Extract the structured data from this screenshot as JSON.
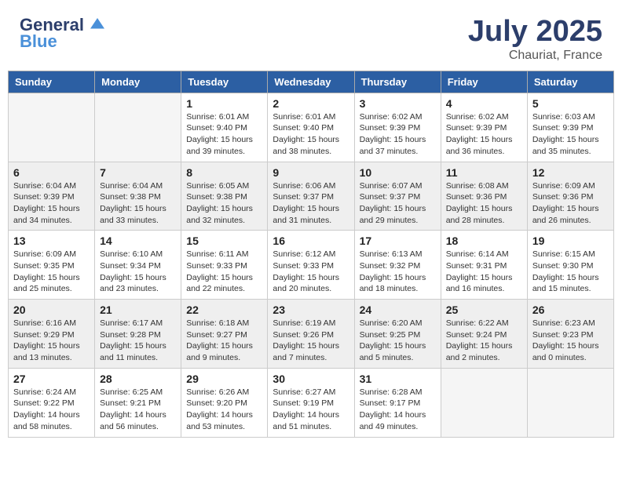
{
  "header": {
    "logo_line1": "General",
    "logo_line2": "Blue",
    "month_year": "July 2025",
    "location": "Chauriat, France"
  },
  "columns": [
    "Sunday",
    "Monday",
    "Tuesday",
    "Wednesday",
    "Thursday",
    "Friday",
    "Saturday"
  ],
  "weeks": [
    [
      {
        "day": "",
        "sunrise": "",
        "sunset": "",
        "daylight": ""
      },
      {
        "day": "",
        "sunrise": "",
        "sunset": "",
        "daylight": ""
      },
      {
        "day": "1",
        "sunrise": "Sunrise: 6:01 AM",
        "sunset": "Sunset: 9:40 PM",
        "daylight": "Daylight: 15 hours and 39 minutes."
      },
      {
        "day": "2",
        "sunrise": "Sunrise: 6:01 AM",
        "sunset": "Sunset: 9:40 PM",
        "daylight": "Daylight: 15 hours and 38 minutes."
      },
      {
        "day": "3",
        "sunrise": "Sunrise: 6:02 AM",
        "sunset": "Sunset: 9:39 PM",
        "daylight": "Daylight: 15 hours and 37 minutes."
      },
      {
        "day": "4",
        "sunrise": "Sunrise: 6:02 AM",
        "sunset": "Sunset: 9:39 PM",
        "daylight": "Daylight: 15 hours and 36 minutes."
      },
      {
        "day": "5",
        "sunrise": "Sunrise: 6:03 AM",
        "sunset": "Sunset: 9:39 PM",
        "daylight": "Daylight: 15 hours and 35 minutes."
      }
    ],
    [
      {
        "day": "6",
        "sunrise": "Sunrise: 6:04 AM",
        "sunset": "Sunset: 9:39 PM",
        "daylight": "Daylight: 15 hours and 34 minutes."
      },
      {
        "day": "7",
        "sunrise": "Sunrise: 6:04 AM",
        "sunset": "Sunset: 9:38 PM",
        "daylight": "Daylight: 15 hours and 33 minutes."
      },
      {
        "day": "8",
        "sunrise": "Sunrise: 6:05 AM",
        "sunset": "Sunset: 9:38 PM",
        "daylight": "Daylight: 15 hours and 32 minutes."
      },
      {
        "day": "9",
        "sunrise": "Sunrise: 6:06 AM",
        "sunset": "Sunset: 9:37 PM",
        "daylight": "Daylight: 15 hours and 31 minutes."
      },
      {
        "day": "10",
        "sunrise": "Sunrise: 6:07 AM",
        "sunset": "Sunset: 9:37 PM",
        "daylight": "Daylight: 15 hours and 29 minutes."
      },
      {
        "day": "11",
        "sunrise": "Sunrise: 6:08 AM",
        "sunset": "Sunset: 9:36 PM",
        "daylight": "Daylight: 15 hours and 28 minutes."
      },
      {
        "day": "12",
        "sunrise": "Sunrise: 6:09 AM",
        "sunset": "Sunset: 9:36 PM",
        "daylight": "Daylight: 15 hours and 26 minutes."
      }
    ],
    [
      {
        "day": "13",
        "sunrise": "Sunrise: 6:09 AM",
        "sunset": "Sunset: 9:35 PM",
        "daylight": "Daylight: 15 hours and 25 minutes."
      },
      {
        "day": "14",
        "sunrise": "Sunrise: 6:10 AM",
        "sunset": "Sunset: 9:34 PM",
        "daylight": "Daylight: 15 hours and 23 minutes."
      },
      {
        "day": "15",
        "sunrise": "Sunrise: 6:11 AM",
        "sunset": "Sunset: 9:33 PM",
        "daylight": "Daylight: 15 hours and 22 minutes."
      },
      {
        "day": "16",
        "sunrise": "Sunrise: 6:12 AM",
        "sunset": "Sunset: 9:33 PM",
        "daylight": "Daylight: 15 hours and 20 minutes."
      },
      {
        "day": "17",
        "sunrise": "Sunrise: 6:13 AM",
        "sunset": "Sunset: 9:32 PM",
        "daylight": "Daylight: 15 hours and 18 minutes."
      },
      {
        "day": "18",
        "sunrise": "Sunrise: 6:14 AM",
        "sunset": "Sunset: 9:31 PM",
        "daylight": "Daylight: 15 hours and 16 minutes."
      },
      {
        "day": "19",
        "sunrise": "Sunrise: 6:15 AM",
        "sunset": "Sunset: 9:30 PM",
        "daylight": "Daylight: 15 hours and 15 minutes."
      }
    ],
    [
      {
        "day": "20",
        "sunrise": "Sunrise: 6:16 AM",
        "sunset": "Sunset: 9:29 PM",
        "daylight": "Daylight: 15 hours and 13 minutes."
      },
      {
        "day": "21",
        "sunrise": "Sunrise: 6:17 AM",
        "sunset": "Sunset: 9:28 PM",
        "daylight": "Daylight: 15 hours and 11 minutes."
      },
      {
        "day": "22",
        "sunrise": "Sunrise: 6:18 AM",
        "sunset": "Sunset: 9:27 PM",
        "daylight": "Daylight: 15 hours and 9 minutes."
      },
      {
        "day": "23",
        "sunrise": "Sunrise: 6:19 AM",
        "sunset": "Sunset: 9:26 PM",
        "daylight": "Daylight: 15 hours and 7 minutes."
      },
      {
        "day": "24",
        "sunrise": "Sunrise: 6:20 AM",
        "sunset": "Sunset: 9:25 PM",
        "daylight": "Daylight: 15 hours and 5 minutes."
      },
      {
        "day": "25",
        "sunrise": "Sunrise: 6:22 AM",
        "sunset": "Sunset: 9:24 PM",
        "daylight": "Daylight: 15 hours and 2 minutes."
      },
      {
        "day": "26",
        "sunrise": "Sunrise: 6:23 AM",
        "sunset": "Sunset: 9:23 PM",
        "daylight": "Daylight: 15 hours and 0 minutes."
      }
    ],
    [
      {
        "day": "27",
        "sunrise": "Sunrise: 6:24 AM",
        "sunset": "Sunset: 9:22 PM",
        "daylight": "Daylight: 14 hours and 58 minutes."
      },
      {
        "day": "28",
        "sunrise": "Sunrise: 6:25 AM",
        "sunset": "Sunset: 9:21 PM",
        "daylight": "Daylight: 14 hours and 56 minutes."
      },
      {
        "day": "29",
        "sunrise": "Sunrise: 6:26 AM",
        "sunset": "Sunset: 9:20 PM",
        "daylight": "Daylight: 14 hours and 53 minutes."
      },
      {
        "day": "30",
        "sunrise": "Sunrise: 6:27 AM",
        "sunset": "Sunset: 9:19 PM",
        "daylight": "Daylight: 14 hours and 51 minutes."
      },
      {
        "day": "31",
        "sunrise": "Sunrise: 6:28 AM",
        "sunset": "Sunset: 9:17 PM",
        "daylight": "Daylight: 14 hours and 49 minutes."
      },
      {
        "day": "",
        "sunrise": "",
        "sunset": "",
        "daylight": ""
      },
      {
        "day": "",
        "sunrise": "",
        "sunset": "",
        "daylight": ""
      }
    ]
  ]
}
